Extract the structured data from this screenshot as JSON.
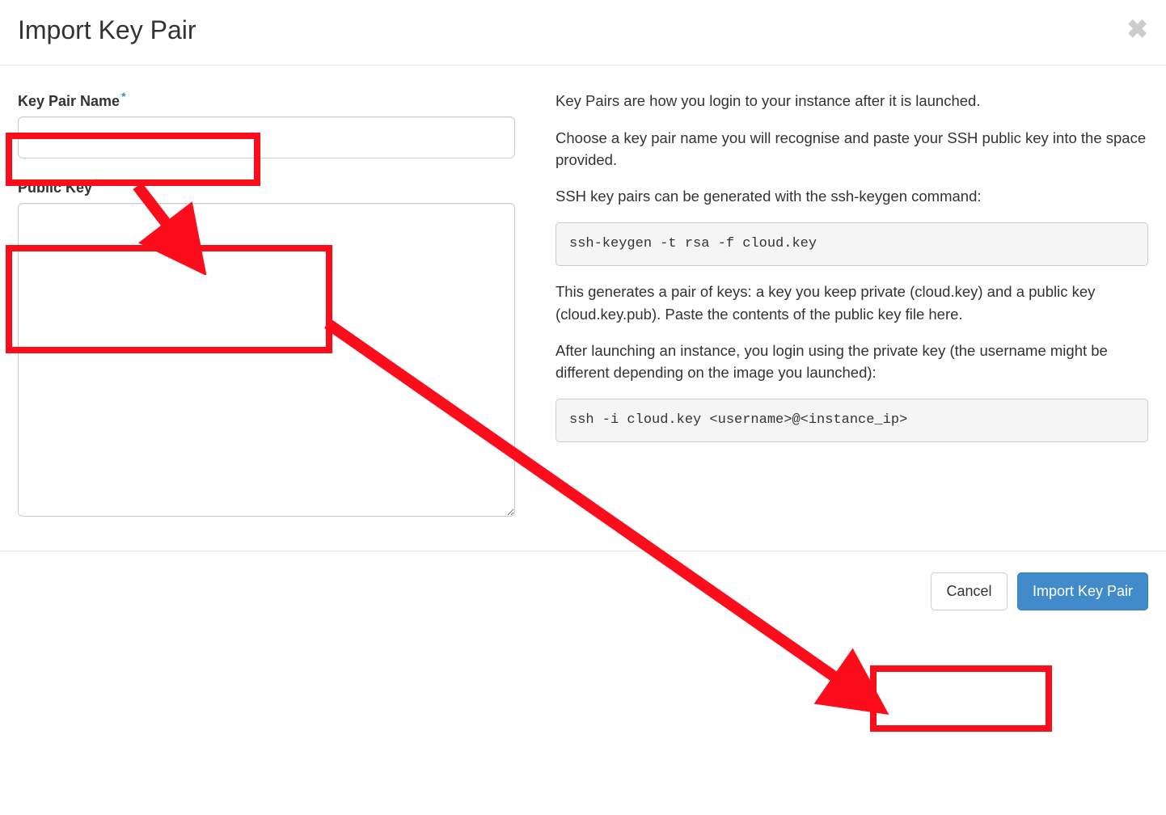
{
  "header": {
    "title": "Import Key Pair"
  },
  "form": {
    "key_pair_name": {
      "label": "Key Pair Name",
      "value": ""
    },
    "public_key": {
      "label": "Public Key",
      "value": ""
    }
  },
  "help": {
    "p1": "Key Pairs are how you login to your instance after it is launched.",
    "p2": "Choose a key pair name you will recognise and paste your SSH public key into the space provided.",
    "p3": "SSH key pairs can be generated with the ssh-keygen command:",
    "code1": "ssh-keygen -t rsa -f cloud.key",
    "p4": "This generates a pair of keys: a key you keep private (cloud.key) and a public key (cloud.key.pub). Paste the contents of the public key file here.",
    "p5": "After launching an instance, you login using the private key (the username might be different depending on the image you launched):",
    "code2": "ssh -i cloud.key <username>@<instance_ip>"
  },
  "footer": {
    "cancel": "Cancel",
    "submit": "Import Key Pair"
  }
}
